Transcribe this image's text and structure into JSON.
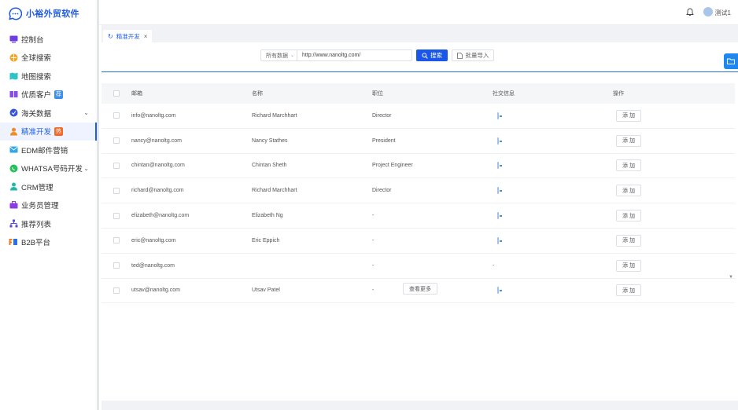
{
  "app": {
    "name": "小裕外贸软件"
  },
  "sidebar": {
    "items": [
      {
        "label": "控制台"
      },
      {
        "label": "全球搜索"
      },
      {
        "label": "地图搜索"
      },
      {
        "label": "优质客户"
      },
      {
        "label": "海关数据"
      },
      {
        "label": "精准开发"
      },
      {
        "label": "EDM邮件营销"
      },
      {
        "label": "WHATSA号码开发"
      },
      {
        "label": "CRM管理"
      },
      {
        "label": "业务员管理"
      },
      {
        "label": "推荐列表"
      },
      {
        "label": "B2B平台"
      }
    ],
    "badges": {
      "vip": "荐",
      "hot": "热"
    }
  },
  "header": {
    "user_name": "测试1"
  },
  "tabs": [
    {
      "label": "精准开发"
    }
  ],
  "search": {
    "scope": "所有数据",
    "url_value": "http://www.nanoltg.com/",
    "search_label": "搜索",
    "import_label": "批量导入"
  },
  "table": {
    "columns": {
      "email": "邮箱",
      "name": "名称",
      "position": "职位",
      "social": "社交信息",
      "action": "操作"
    },
    "add_label": "添 加",
    "rows": [
      {
        "email": "info@nanoltg.com",
        "name": "Richard Marchhart",
        "position": "Director",
        "social": "icon"
      },
      {
        "email": "nancy@nanoltg.com",
        "name": "Nancy Stathes",
        "position": "President",
        "social": "icon"
      },
      {
        "email": "chintan@nanoltg.com",
        "name": "Chintan Sheth",
        "position": "Project Engineer",
        "social": "icon"
      },
      {
        "email": "richard@nanoltg.com",
        "name": "Richard Marchhart",
        "position": "Director",
        "social": "icon"
      },
      {
        "email": "elizabeth@nanoltg.com",
        "name": "Elizabeth Ng",
        "position": "-",
        "social": "icon"
      },
      {
        "email": "eric@nanoltg.com",
        "name": "Eric Eppich",
        "position": "-",
        "social": "icon"
      },
      {
        "email": "ted@nanoltg.com",
        "name": "",
        "position": "-",
        "social": "-"
      },
      {
        "email": "utsav@nanoltg.com",
        "name": "Utsav Patel",
        "position": "-",
        "social": "icon"
      }
    ],
    "more_label": "查看更多"
  },
  "colors": {
    "accent": "#1a56e8",
    "active_bg": "#eef3ff"
  }
}
